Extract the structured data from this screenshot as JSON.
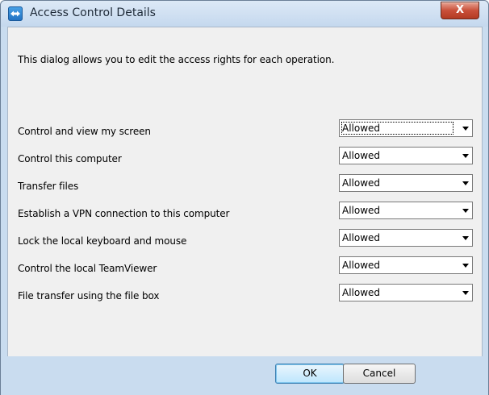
{
  "window": {
    "title": "Access Control Details",
    "close_label": "X"
  },
  "intro_text": "This dialog allows you to edit the access rights for each operation.",
  "rows": [
    {
      "label": "Control and view my screen",
      "value": "Allowed",
      "focused": true
    },
    {
      "label": "Control this computer",
      "value": "Allowed"
    },
    {
      "label": "Transfer files",
      "value": "Allowed"
    },
    {
      "label": "Establish a VPN connection to this computer",
      "value": "Allowed"
    },
    {
      "label": "Lock the local keyboard and mouse",
      "value": "Allowed"
    },
    {
      "label": "Control the local TeamViewer",
      "value": "Allowed"
    },
    {
      "label": "File transfer using the file box",
      "value": "Allowed"
    }
  ],
  "buttons": {
    "ok_label": "OK",
    "cancel_label": "Cancel"
  },
  "icons": {
    "app": "teamviewer-icon",
    "close": "close-icon",
    "dropdown": "chevron-down-icon"
  }
}
